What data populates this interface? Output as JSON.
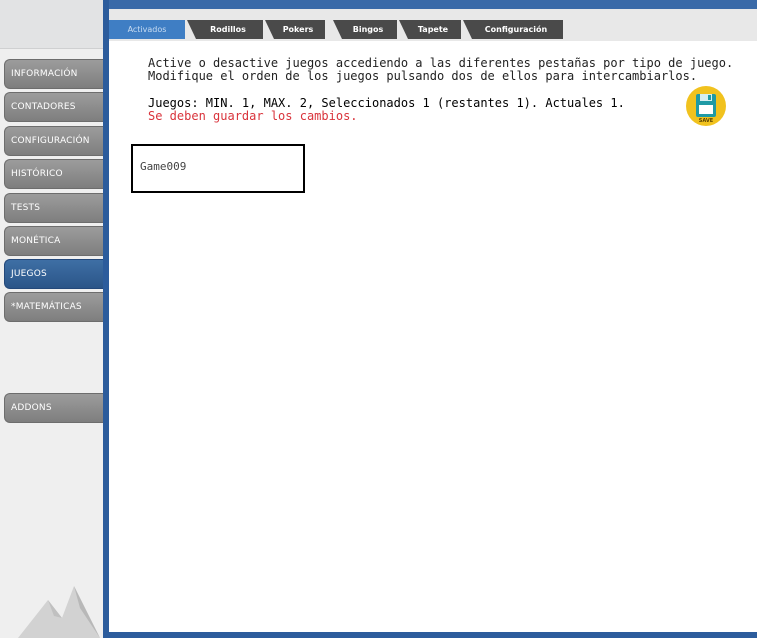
{
  "sidebar": {
    "items": [
      {
        "label": "INFORMACIÓN",
        "active": false
      },
      {
        "label": "CONTADORES",
        "active": false
      },
      {
        "label": "CONFIGURACIÓN",
        "active": false
      },
      {
        "label": "HISTÓRICO",
        "active": false
      },
      {
        "label": "TESTS",
        "active": false
      },
      {
        "label": "MONÉTICA",
        "active": false
      },
      {
        "label": "JUEGOS",
        "active": true
      },
      {
        "label": "*MATEMÁTICAS",
        "active": false
      },
      {
        "label": "ADDONS",
        "active": false
      }
    ],
    "logo_icon": "mountain-logo-icon"
  },
  "tabs": [
    {
      "label": "Activados",
      "active": true
    },
    {
      "label": "Rodillos",
      "active": false
    },
    {
      "label": "Pokers",
      "active": false
    },
    {
      "label": "Bingos",
      "active": false
    },
    {
      "label": "Tapete",
      "active": false
    },
    {
      "label": "Configuración",
      "active": false
    }
  ],
  "main": {
    "instructions": [
      "Active o desactive juegos accediendo a las diferentes pestañas por tipo de juego.",
      "Modifique el orden de los juegos pulsando dos de ellos para intercambiarlos."
    ],
    "status_line": "Juegos: MIN. 1, MAX. 2, Seleccionados 1 (restantes 1). Actuales 1.",
    "warning": "Se deben guardar los cambios.",
    "save_button": {
      "label": "SAVE",
      "icon": "floppy-disk-icon"
    },
    "games": [
      "Game009"
    ]
  },
  "colors": {
    "accent_blue": "#2c5c9c",
    "active_tab": "#3f7ec4",
    "inactive_tab": "#4a4a4a",
    "warning_red": "#d9333b",
    "save_yellow": "#f1c21e"
  }
}
